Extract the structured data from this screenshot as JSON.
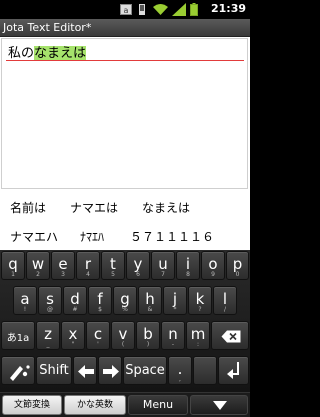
{
  "status_bar": {
    "time": "21:39"
  },
  "app": {
    "title": "Jota Text Editor*"
  },
  "editor": {
    "text_plain": "私の",
    "text_composing": "なまえは"
  },
  "candidates": {
    "row1": [
      "名前は",
      "ナマエは",
      "なまえは"
    ],
    "row2": [
      "ナマエハ",
      "ﾅﾏｴﾊ",
      "５７１１１１６"
    ]
  },
  "keyboard": {
    "row1": [
      {
        "main": "q",
        "hint": "1"
      },
      {
        "main": "w",
        "hint": "2"
      },
      {
        "main": "e",
        "hint": "3"
      },
      {
        "main": "r",
        "hint": "4"
      },
      {
        "main": "t",
        "hint": "5"
      },
      {
        "main": "y",
        "hint": "6"
      },
      {
        "main": "u",
        "hint": "7"
      },
      {
        "main": "i",
        "hint": "8"
      },
      {
        "main": "o",
        "hint": "9"
      },
      {
        "main": "p",
        "hint": "0"
      }
    ],
    "row2": [
      {
        "main": "a",
        "hint": "!"
      },
      {
        "main": "s",
        "hint": "@"
      },
      {
        "main": "d",
        "hint": "#"
      },
      {
        "main": "f",
        "hint": "$"
      },
      {
        "main": "g",
        "hint": "%"
      },
      {
        "main": "h",
        "hint": "&"
      },
      {
        "main": "j",
        "hint": "*"
      },
      {
        "main": "k",
        "hint": "?"
      },
      {
        "main": "l",
        "hint": "/"
      }
    ],
    "row3": [
      {
        "main": "z",
        "hint": "_"
      },
      {
        "main": "x",
        "hint": "\""
      },
      {
        "main": "c",
        "hint": "'"
      },
      {
        "main": "v",
        "hint": "("
      },
      {
        "main": "b",
        "hint": ")"
      },
      {
        "main": "n",
        "hint": "-"
      },
      {
        "main": "m",
        "hint": ":"
      }
    ],
    "mode_key": "あ1a",
    "shift_label": "Shift",
    "space_label": "Space",
    "dot_label": ".",
    "dot_hint": ","
  },
  "navbar": {
    "btn1": "文節変換",
    "btn2": "かな英数",
    "btn3": "Menu"
  },
  "colors": {
    "composing_highlight": "#a6e36c",
    "underline": "#e23b3b"
  }
}
